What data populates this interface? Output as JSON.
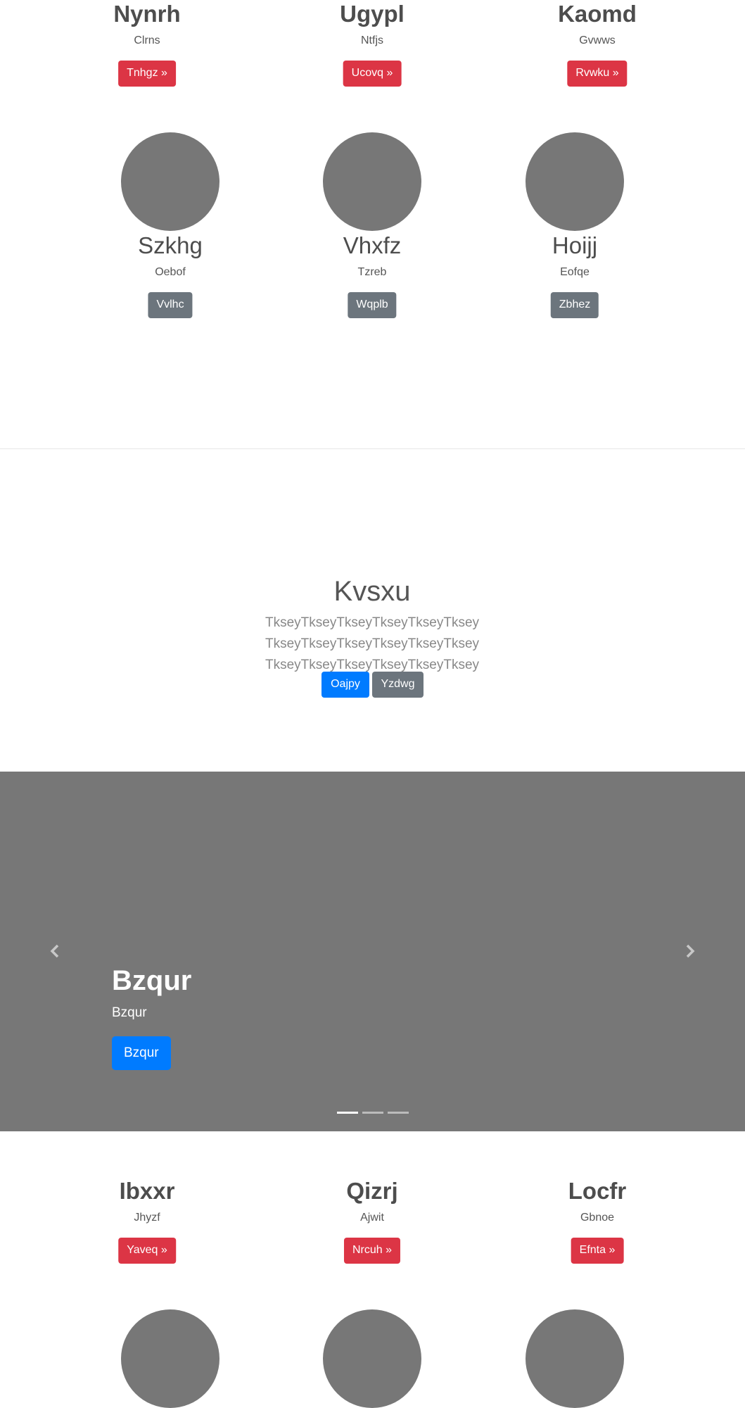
{
  "top_row": [
    {
      "title": "Nynrh",
      "subtitle": "Clrns",
      "button": "Tnhgz »"
    },
    {
      "title": "Ugypl",
      "subtitle": "Ntfjs",
      "button": "Ucovq »"
    },
    {
      "title": "Kaomd",
      "subtitle": "Gvwws",
      "button": "Rvwku »"
    }
  ],
  "profiles": [
    {
      "name": "Szkhg",
      "role": "Oebof",
      "button": "Vvlhc"
    },
    {
      "name": "Vhxfz",
      "role": "Tzreb",
      "button": "Wqplb"
    },
    {
      "name": "Hoijj",
      "role": "Eofqe",
      "button": "Zbhez"
    }
  ],
  "hero": {
    "title": "Kvsxu",
    "text": "TkseyTkseyTkseyTkseyTkseyTksey TkseyTkseyTkseyTkseyTkseyTksey TkseyTkseyTkseyTkseyTkseyTksey",
    "primary_button": "Oajpy",
    "secondary_button": "Yzdwg"
  },
  "carousel": {
    "slide_title": "Bzqur",
    "slide_text": "Bzqur",
    "slide_button": "Bzqur",
    "prev_icon": "chevron-left-icon",
    "next_icon": "chevron-right-icon",
    "indicator_count": 3,
    "active_index": 0
  },
  "bottom_row": [
    {
      "title": "Ibxxr",
      "subtitle": "Jhyzf",
      "button": "Yaveq »"
    },
    {
      "title": "Qizrj",
      "subtitle": "Ajwit",
      "button": "Nrcuh »"
    },
    {
      "title": "Locfr",
      "subtitle": "Gbnoe",
      "button": "Efnta »"
    }
  ],
  "colors": {
    "danger": "#dc3545",
    "secondary": "#6c757d",
    "primary": "#007bff",
    "placeholder": "#777777"
  }
}
